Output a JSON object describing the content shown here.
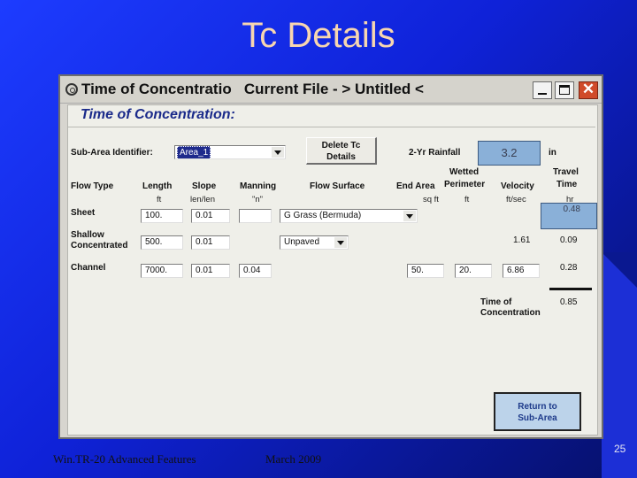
{
  "slide": {
    "title": "Tc Details",
    "footer_left": "Win.TR-20 Advanced Features",
    "footer_center": "March 2009",
    "page_number": "25"
  },
  "window": {
    "title_left": "Time of Concentratio",
    "title_right": "Current File - > Untitled <",
    "close_glyph": "✕",
    "icons": [
      "app-icon",
      "minimize-icon",
      "maximize-icon",
      "close-icon"
    ]
  },
  "form": {
    "heading": "Time of Concentration:",
    "subarea_label": "Sub-Area Identifier:",
    "subarea_value": "Area_1",
    "delete_button": [
      "Delete Tc",
      "Details"
    ],
    "rainfall_label": "2-Yr Rainfall",
    "rainfall_value": "3.2",
    "rainfall_unit": "in",
    "headers": {
      "flow_type": "Flow Type",
      "length": "Length",
      "slope": "Slope",
      "manning": "Manning",
      "flow_surface": "Flow Surface",
      "end_area": "End Area",
      "wetted": "Wetted",
      "perimeter": "Perimeter",
      "velocity": "Velocity",
      "travel": "Travel",
      "time": "Time"
    },
    "units": {
      "length": "ft",
      "slope": "len/len",
      "manning": "\"n\"",
      "end_area": "sq ft",
      "perimeter": "ft",
      "velocity": "ft/sec",
      "time": "hr"
    },
    "rows": [
      {
        "label": "Sheet",
        "length": "100.",
        "slope": "0.01",
        "manning": "",
        "surface": "G Grass (Bermuda)",
        "travel_time": "0.48"
      },
      {
        "label_line1": "Shallow",
        "label_line2": "Concentrated",
        "length": "500.",
        "slope": "0.01",
        "surface": "Unpaved",
        "velocity": "1.61",
        "travel_time": "0.09"
      },
      {
        "label": "Channel",
        "length": "7000.",
        "slope": "0.01",
        "manning": "0.04",
        "end_area": "50.",
        "perimeter": "20.",
        "velocity": "6.86",
        "travel_time": "0.28"
      }
    ],
    "total_label_line1": "Time of",
    "total_label_line2": "Concentration",
    "total_value": "0.85",
    "return_button": [
      "Return to",
      "Sub-Area"
    ]
  },
  "colors": {
    "slide_bg": "#1d3cff",
    "title_color": "#f7d6b0",
    "window_bg": "#d7d5cf",
    "heading_color": "#1a2a8a",
    "highlight_box": "#8ab0d8",
    "close_button": "#d04b2a"
  }
}
